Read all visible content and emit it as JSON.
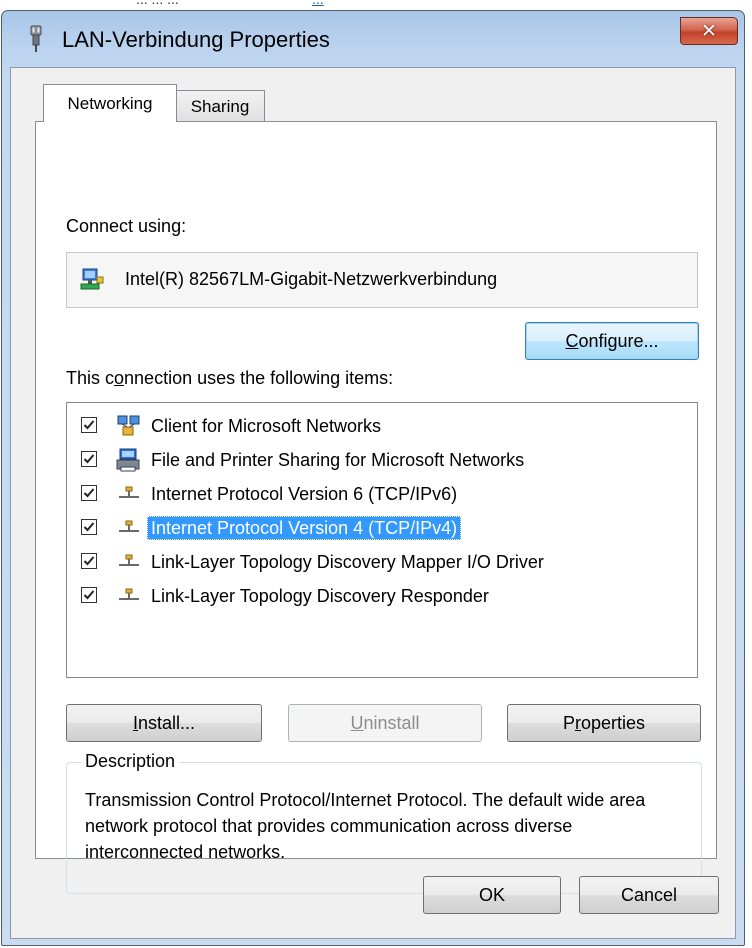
{
  "page_top_fragment": "... ... ...",
  "page_top_link": "...",
  "window": {
    "title": "LAN-Verbindung Properties",
    "close_label": "✕"
  },
  "tabs": [
    {
      "label": "Networking",
      "active": true
    },
    {
      "label": "Sharing",
      "active": false
    }
  ],
  "connect_using": {
    "label": "Connect using:",
    "adapter_name": "Intel(R) 82567LM-Gigabit-Netzwerkverbindung"
  },
  "configure_button": {
    "pre": "",
    "accel": "C",
    "post": "onfigure..."
  },
  "items_section": {
    "label_pre": "This c",
    "label_accel": "o",
    "label_post": "nnection uses the following items:",
    "items": [
      {
        "label": "Client for Microsoft Networks",
        "checked": true,
        "icon": "network-client-icon"
      },
      {
        "label": "File and Printer Sharing for Microsoft Networks",
        "checked": true,
        "icon": "printer-sharing-icon"
      },
      {
        "label": "Internet Protocol Version 6 (TCP/IPv6)",
        "checked": true,
        "icon": "protocol-icon"
      },
      {
        "label": "Internet Protocol Version 4 (TCP/IPv4)",
        "checked": true,
        "icon": "protocol-icon",
        "selected": true
      },
      {
        "label": "Link-Layer Topology Discovery Mapper I/O Driver",
        "checked": true,
        "icon": "protocol-icon"
      },
      {
        "label": "Link-Layer Topology Discovery Responder",
        "checked": true,
        "icon": "protocol-icon"
      }
    ]
  },
  "buttons": {
    "install": {
      "pre": "",
      "accel": "I",
      "post": "nstall..."
    },
    "uninstall": {
      "pre": "",
      "accel": "U",
      "post": "ninstall"
    },
    "properties": {
      "pre": "P",
      "accel": "r",
      "post": "operties"
    },
    "ok": "OK",
    "cancel": "Cancel"
  },
  "description": {
    "legend": "Description",
    "text": "Transmission Control Protocol/Internet Protocol. The default wide area network protocol that provides communication across diverse interconnected networks."
  },
  "colors": {
    "selection": "#3399ff",
    "close_button": "#c2422a",
    "titlebar": "#bcd4ef"
  }
}
